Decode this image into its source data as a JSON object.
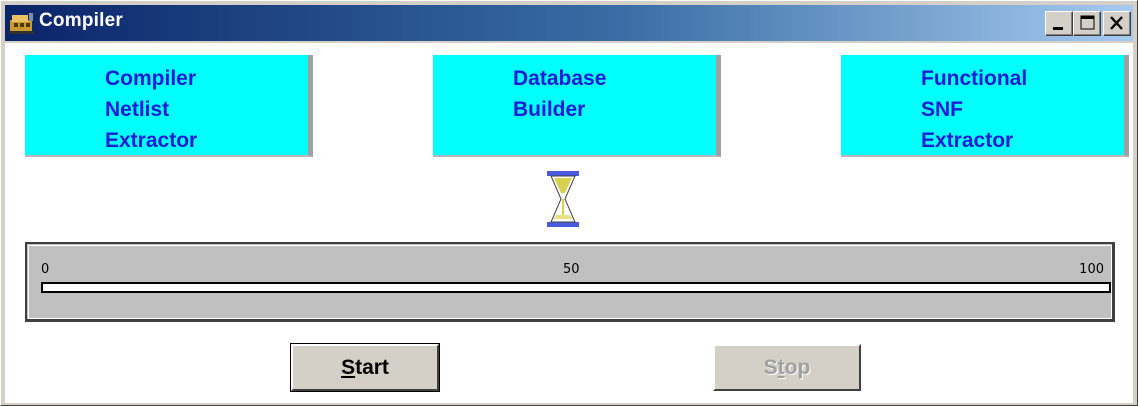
{
  "window": {
    "title": "Compiler",
    "controls": {
      "minimize": "minimize-icon",
      "maximize": "maximize-icon",
      "close": "close-icon"
    }
  },
  "stages": [
    {
      "label": "Compiler\nNetlist\nExtractor"
    },
    {
      "label": "Database\nBuilder"
    },
    {
      "label": "Functional\nSNF\nExtractor"
    }
  ],
  "colors": {
    "stage_bg": "#00ffff",
    "stage_text": "#1c1cd8",
    "title_gradient_start": "#0a246a"
  },
  "status_icon": "hourglass-icon",
  "progress": {
    "min_label": "0",
    "mid_label": "50",
    "max_label": "100",
    "value_percent": 0
  },
  "buttons": {
    "start": {
      "mnemonic": "S",
      "rest": "tart",
      "enabled": true
    },
    "stop": {
      "pre": "S",
      "mnemonic": "t",
      "rest": "op",
      "enabled": false
    }
  }
}
